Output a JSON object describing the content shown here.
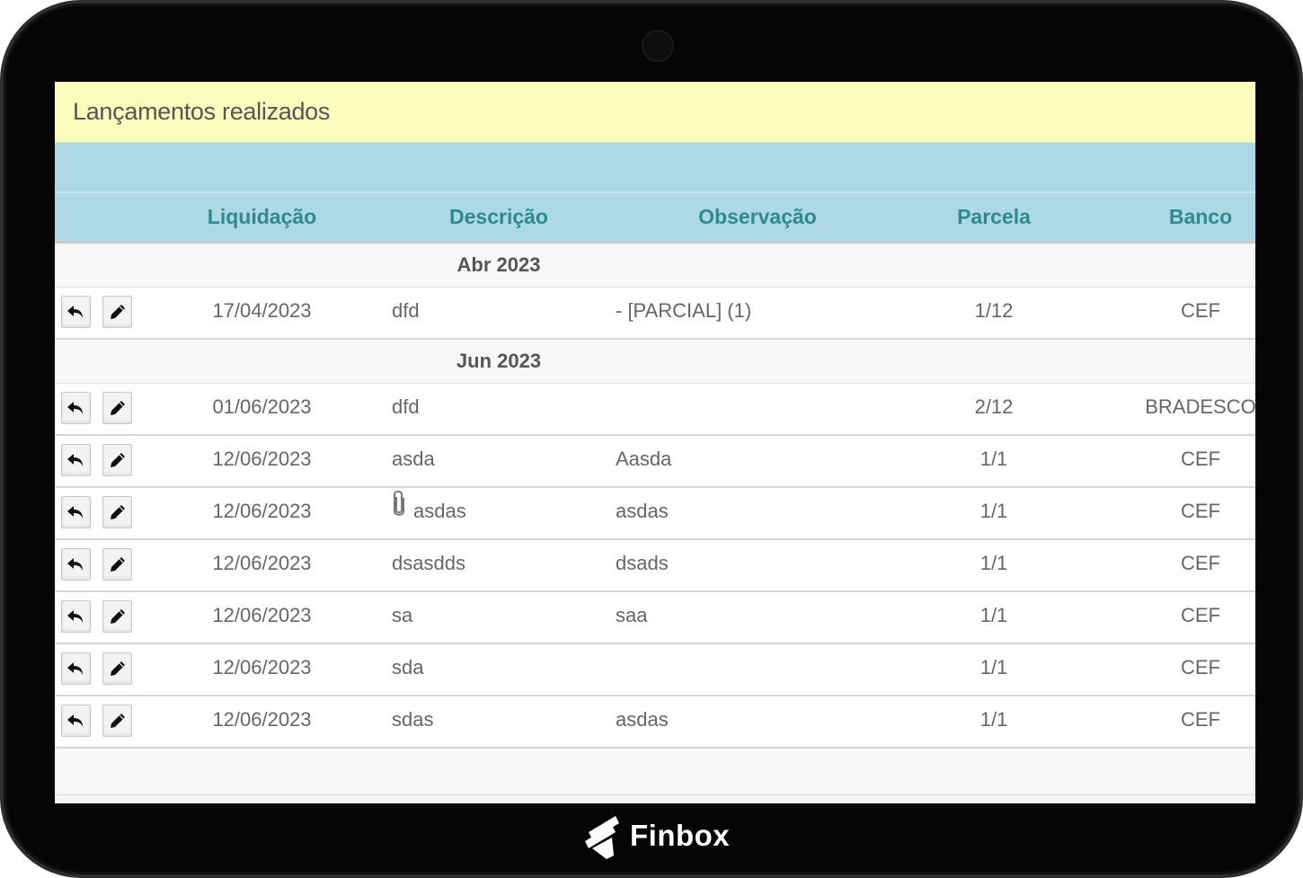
{
  "device": {
    "brand": "Finbox"
  },
  "page": {
    "title": "Lançamentos realizados"
  },
  "columns": {
    "liquidacao": "Liquidação",
    "descricao": "Descrição",
    "observacao": "Observação",
    "parcela": "Parcela",
    "banco": "Banco"
  },
  "groups": [
    {
      "label": "Abr 2023",
      "rows": [
        {
          "liquidacao": "17/04/2023",
          "descricao": "dfd",
          "observacao": "- [PARCIAL] (1)",
          "parcela": "1/12",
          "banco": "CEF",
          "attachment": false
        }
      ]
    },
    {
      "label": "Jun 2023",
      "rows": [
        {
          "liquidacao": "01/06/2023",
          "descricao": "dfd",
          "observacao": "",
          "parcela": "2/12",
          "banco": "BRADESCO",
          "attachment": false
        },
        {
          "liquidacao": "12/06/2023",
          "descricao": "asda",
          "observacao": "Aasda",
          "parcela": "1/1",
          "banco": "CEF",
          "attachment": false
        },
        {
          "liquidacao": "12/06/2023",
          "descricao": "asdas",
          "observacao": "asdas",
          "parcela": "1/1",
          "banco": "CEF",
          "attachment": true
        },
        {
          "liquidacao": "12/06/2023",
          "descricao": "dsasdds",
          "observacao": "dsads",
          "parcela": "1/1",
          "banco": "CEF",
          "attachment": false
        },
        {
          "liquidacao": "12/06/2023",
          "descricao": "sa",
          "observacao": "saa",
          "parcela": "1/1",
          "banco": "CEF",
          "attachment": false
        },
        {
          "liquidacao": "12/06/2023",
          "descricao": "sda",
          "observacao": "",
          "parcela": "1/1",
          "banco": "CEF",
          "attachment": false
        },
        {
          "liquidacao": "12/06/2023",
          "descricao": "sdas",
          "observacao": "asdas",
          "parcela": "1/1",
          "banco": "CEF",
          "attachment": false
        }
      ]
    }
  ],
  "icons": {
    "row_actions": [
      "undo-icon",
      "pencil-icon"
    ],
    "attachment": "paperclip-icon"
  },
  "colors": {
    "title_bg": "#fcfcbd",
    "header_bg": "#add8e6",
    "header_text": "#2e8b8b",
    "row_text": "#666666"
  }
}
